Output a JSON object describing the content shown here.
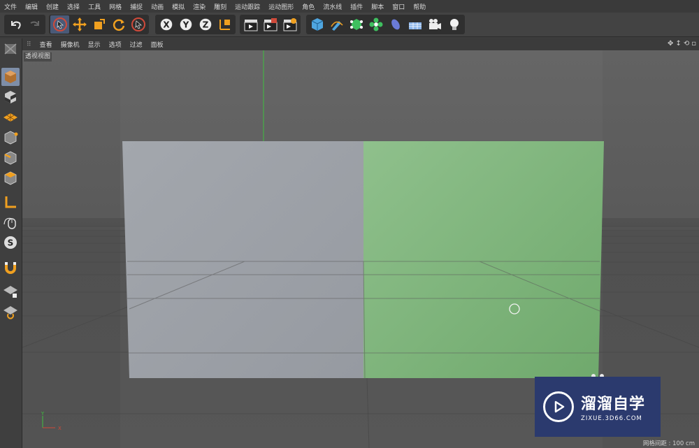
{
  "menu": [
    "文件",
    "编辑",
    "创建",
    "选择",
    "工具",
    "网格",
    "捕捉",
    "动画",
    "模拟",
    "渲染",
    "雕刻",
    "运动跟踪",
    "运动图形",
    "角色",
    "流水线",
    "插件",
    "脚本",
    "窗口",
    "帮助"
  ],
  "viewport_menu": [
    "查看",
    "摄像机",
    "显示",
    "选项",
    "过滤",
    "面板"
  ],
  "viewport_label": "透视视图",
  "axis": {
    "y": "Y",
    "x": "X"
  },
  "watermark": {
    "cn": "溜溜自学",
    "url": "ZIXUE.3D66.COM"
  },
  "grid_info": "网格间距 : 100 cm",
  "colors": {
    "plane_grey": "#9da1a8",
    "plane_green": "#7db47a",
    "bg": "#5b5b5b",
    "accent": "#f0a020"
  }
}
